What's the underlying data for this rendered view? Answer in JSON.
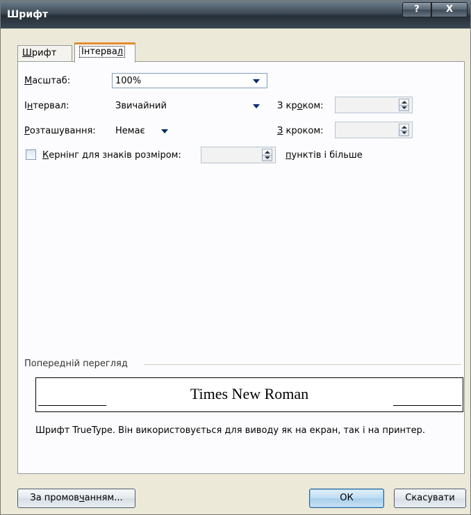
{
  "window": {
    "title": "Шрифт",
    "help_btn": "?",
    "close_btn": "X"
  },
  "tabs": [
    {
      "label": "Шрифт",
      "ul": "Ш",
      "rest": "рифт"
    },
    {
      "label": "Інтервал",
      "pre": "Інтерва",
      "ul": "л",
      "rest": ""
    }
  ],
  "fields": {
    "scale": {
      "label_ul": "М",
      "label_rest": "асштаб:",
      "value": "100%"
    },
    "spacing": {
      "label_pre": "І",
      "label_ul": "н",
      "label_rest": "тервал:",
      "value": "Звичайний",
      "by_pre": "З кр",
      "by_ul": "о",
      "by_rest": "ком:",
      "by_value": ""
    },
    "position": {
      "label_ul": "Р",
      "label_rest": "озташування:",
      "value": "Немає",
      "by_ul": "З",
      "by_rest": " кроком:",
      "by_value": ""
    },
    "kerning": {
      "checked": false,
      "label_ul": "К",
      "label_rest": "ернінг для знаків розміром:",
      "value": "",
      "suffix_ul": "п",
      "suffix_rest": "унктів і більше"
    }
  },
  "preview": {
    "group_label": "Попередній перегляд",
    "sample": "Times New Roman",
    "note": "Шрифт TrueType. Він використовується для виводу як на екран, так і на принтер."
  },
  "buttons": {
    "default_pre": "За промов",
    "default_ul": "ч",
    "default_rest": "анням...",
    "ok": "ОК",
    "cancel": "Скасувати"
  }
}
